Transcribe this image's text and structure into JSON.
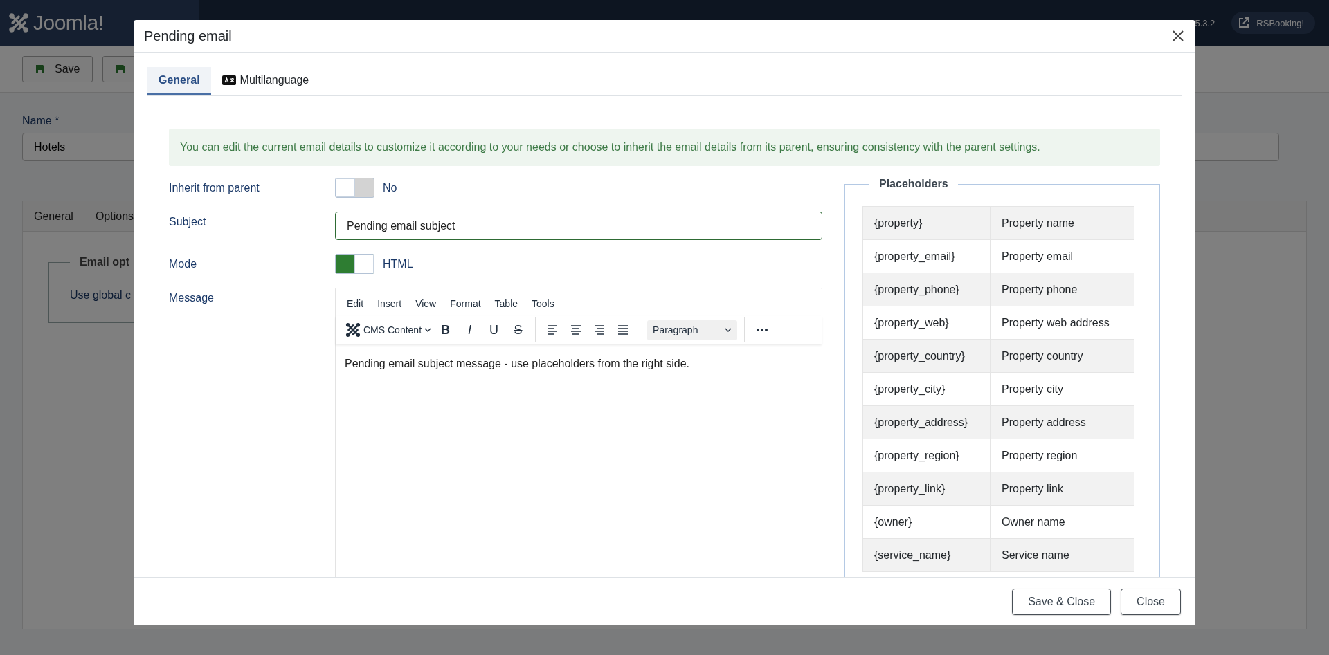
{
  "background": {
    "logo": "Joomla!",
    "version": "5.3.2",
    "header_button": "RSBooking!",
    "toolbar_buttons": [
      "Save"
    ],
    "name_label": "Name *",
    "name_value": "Hotels",
    "tabs": [
      "General",
      "Options"
    ],
    "fieldset_legend": "Email opt",
    "field_label": "Use global c"
  },
  "modal": {
    "title": "Pending email",
    "tabs": [
      {
        "label": "General",
        "selected": true
      },
      {
        "label": "Multilanguage",
        "selected": false
      }
    ],
    "notice": "You can edit the current email details to customize it according to your needs or choose to inherit the email details from its parent, ensuring consistency with the parent settings.",
    "fields": [
      {
        "kind": "toggle",
        "label": "Inherit from parent",
        "on": false,
        "value_label": "No"
      },
      {
        "kind": "text",
        "label": "Subject",
        "value": "Pending email subject"
      },
      {
        "kind": "toggle",
        "label": "Mode",
        "on": true,
        "value_label": "HTML"
      },
      {
        "kind": "editor",
        "label": "Message",
        "menu": [
          "Edit",
          "Insert",
          "View",
          "Format",
          "Table",
          "Tools"
        ],
        "plugin_button": "CMS Content",
        "format_buttons": [
          {
            "kind": "bold",
            "glyph": "B"
          },
          {
            "kind": "italic",
            "glyph": "I"
          },
          {
            "kind": "underline",
            "glyph": "U"
          },
          {
            "kind": "strike",
            "glyph": "S"
          }
        ],
        "block_format": "Paragraph",
        "content": "Pending email subject message - use placeholders from the right side."
      }
    ],
    "placeholders": {
      "legend": "Placeholders",
      "rows": [
        {
          "tag": "{property}",
          "description": "Property name"
        },
        {
          "tag": "{property_email}",
          "description": "Property email"
        },
        {
          "tag": "{property_phone}",
          "description": "Property phone"
        },
        {
          "tag": "{property_web}",
          "description": "Property web address"
        },
        {
          "tag": "{property_country}",
          "description": "Property country"
        },
        {
          "tag": "{property_city}",
          "description": "Property city"
        },
        {
          "tag": "{property_address}",
          "description": "Property address"
        },
        {
          "tag": "{property_region}",
          "description": "Property region"
        },
        {
          "tag": "{property_link}",
          "description": "Property link"
        },
        {
          "tag": "{owner}",
          "description": "Owner name"
        },
        {
          "tag": "{service_name}",
          "description": "Service name"
        }
      ]
    },
    "buttons": [
      "Save & Close",
      "Close"
    ]
  }
}
